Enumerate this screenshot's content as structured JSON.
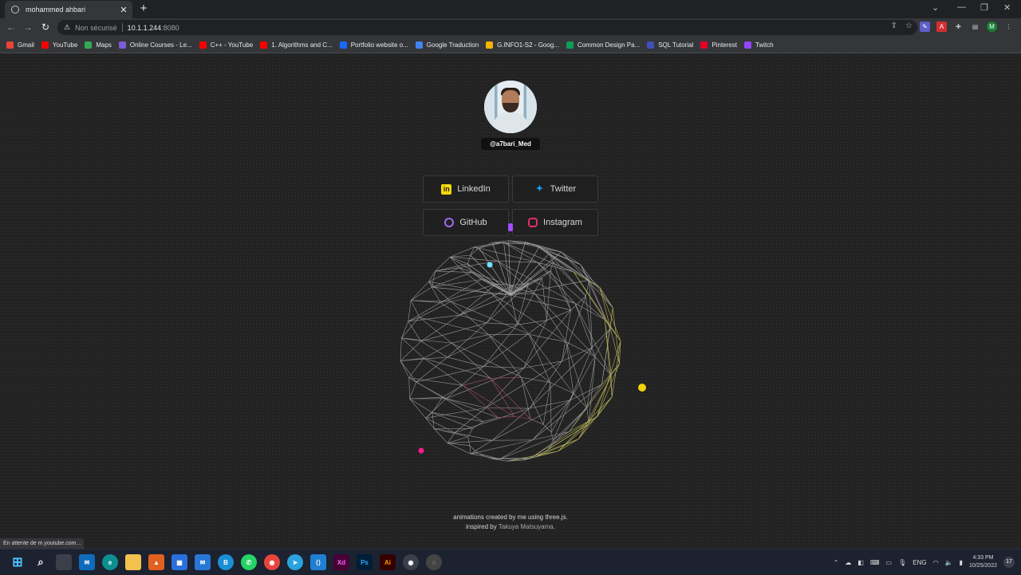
{
  "browser": {
    "tab_title": "mohammed ahbari",
    "address": {
      "insecure_label": "Non sécurisé",
      "host": "10.1.1.244",
      "port": ":8080"
    },
    "status_text": "En attente de m.youtube.com..."
  },
  "bookmarks": [
    {
      "label": "Gmail",
      "color": "#ea4335"
    },
    {
      "label": "YouTube",
      "color": "#ff0000"
    },
    {
      "label": "Maps",
      "color": "#34a853"
    },
    {
      "label": "Online Courses - Le...",
      "color": "#7b5cd6"
    },
    {
      "label": "C++ - YouTube",
      "color": "#ff0000"
    },
    {
      "label": "1. Algorithms and C...",
      "color": "#ff0000"
    },
    {
      "label": "Portfolio website o...",
      "color": "#1769ff"
    },
    {
      "label": "Google Traduction",
      "color": "#4285f4"
    },
    {
      "label": "G.INFO1-S2 - Goog...",
      "color": "#f4b400"
    },
    {
      "label": "Common Design Pa...",
      "color": "#0f9d58"
    },
    {
      "label": "SQL Tutorial",
      "color": "#3f51b5"
    },
    {
      "label": "Pinterest",
      "color": "#e60023"
    },
    {
      "label": "Twitch",
      "color": "#9146ff"
    }
  ],
  "profile": {
    "handle": "@a7bari_Med"
  },
  "social": [
    {
      "label": "LinkedIn",
      "icon": "linkedin-icon",
      "glyph": "in",
      "color": "#f5d90a"
    },
    {
      "label": "Twitter",
      "icon": "twitter-icon",
      "glyph": "🐦",
      "color": "#1d9bf0"
    },
    {
      "label": "GitHub",
      "icon": "github-icon",
      "glyph": "●",
      "color": "#a06cf0"
    },
    {
      "label": "Instagram",
      "icon": "instagram-icon",
      "glyph": "◎",
      "color": "#e1306c"
    }
  ],
  "footer": {
    "line1": "animations created by me using three.js.",
    "line2_prefix": "inspired by ",
    "line2_author": "Takuya Matsuyama",
    "line2_suffix": "."
  },
  "taskbar": {
    "lang": "ENG",
    "time": "4:33 PM",
    "date": "10/25/2022",
    "notif_count": "17",
    "whatsapp_badge": "88"
  }
}
